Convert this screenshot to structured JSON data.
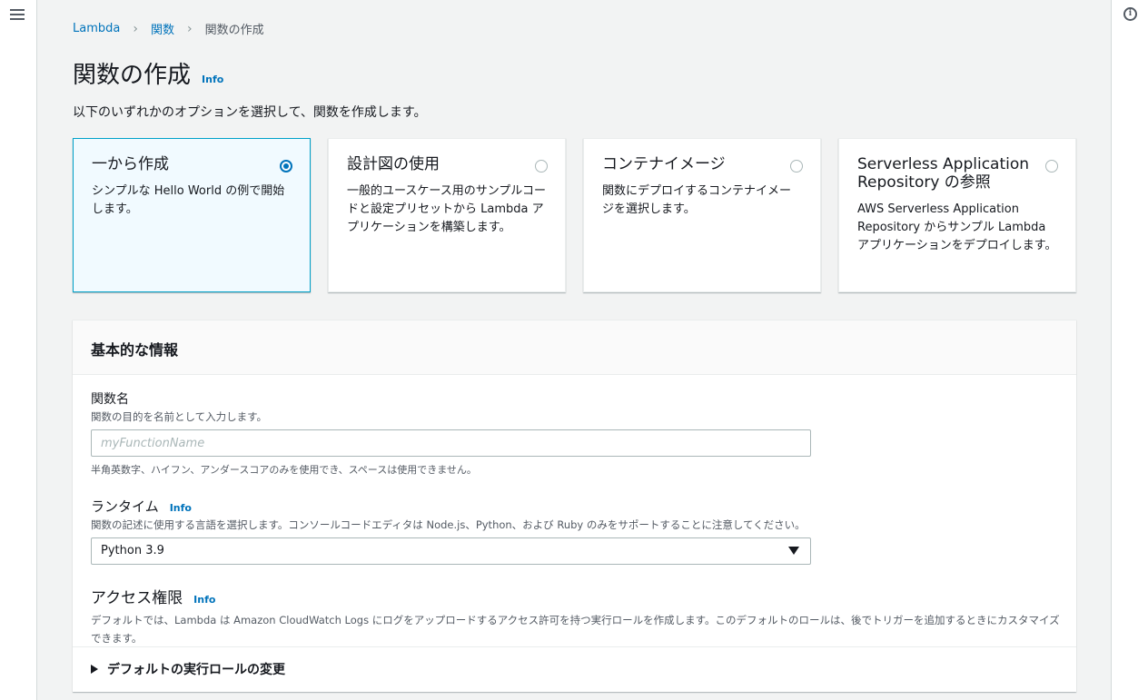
{
  "breadcrumb": {
    "root": "Lambda",
    "functions": "関数",
    "current": "関数の作成"
  },
  "page": {
    "title": "関数の作成",
    "info": "Info",
    "subtitle": "以下のいずれかのオプションを選択して、関数を作成します。"
  },
  "options": [
    {
      "title": "一から作成",
      "description": "シンプルな Hello World の例で開始します。",
      "selected": true
    },
    {
      "title": "設計図の使用",
      "description": "一般的ユースケース用のサンプルコードと設定プリセットから Lambda アプリケーションを構築します。",
      "selected": false
    },
    {
      "title": "コンテナイメージ",
      "description": "関数にデプロイするコンテナイメージを選択します。",
      "selected": false
    },
    {
      "title": "Serverless Application Repository の参照",
      "description": "AWS Serverless Application Repository からサンプル Lambda アプリケーションをデプロイします。",
      "selected": false
    }
  ],
  "basic_info": {
    "header": "基本的な情報",
    "function_name": {
      "label": "関数名",
      "description": "関数の目的を名前として入力します。",
      "placeholder": "myFunctionName",
      "value": "",
      "constraint": "半角英数字、ハイフン、アンダースコアのみを使用でき、スペースは使用できません。"
    },
    "runtime": {
      "label": "ランタイム",
      "info": "Info",
      "description": "関数の記述に使用する言語を選択します。コンソールコードエディタは Node.js、Python、および Ruby のみをサポートすることに注意してください。",
      "selected": "Python 3.9"
    },
    "permissions": {
      "label": "アクセス権限",
      "info": "Info",
      "description": "デフォルトでは、Lambda は Amazon CloudWatch Logs にログをアップロードするアクセス許可を持つ実行ロールを作成します。このデフォルトのロールは、後でトリガーを追加するときにカスタマイズできます。"
    },
    "expander": "デフォルトの実行ロールの変更"
  },
  "colors": {
    "link": "#0073bb",
    "selected_bg": "#f1faff",
    "selected_border": "#00a1c9",
    "page_bg": "#f2f3f3"
  },
  "icons": {
    "menu": "hamburger-menu-icon",
    "info": "info-circle-icon",
    "caret": "caret-down-icon",
    "expand": "triangle-right-icon"
  }
}
